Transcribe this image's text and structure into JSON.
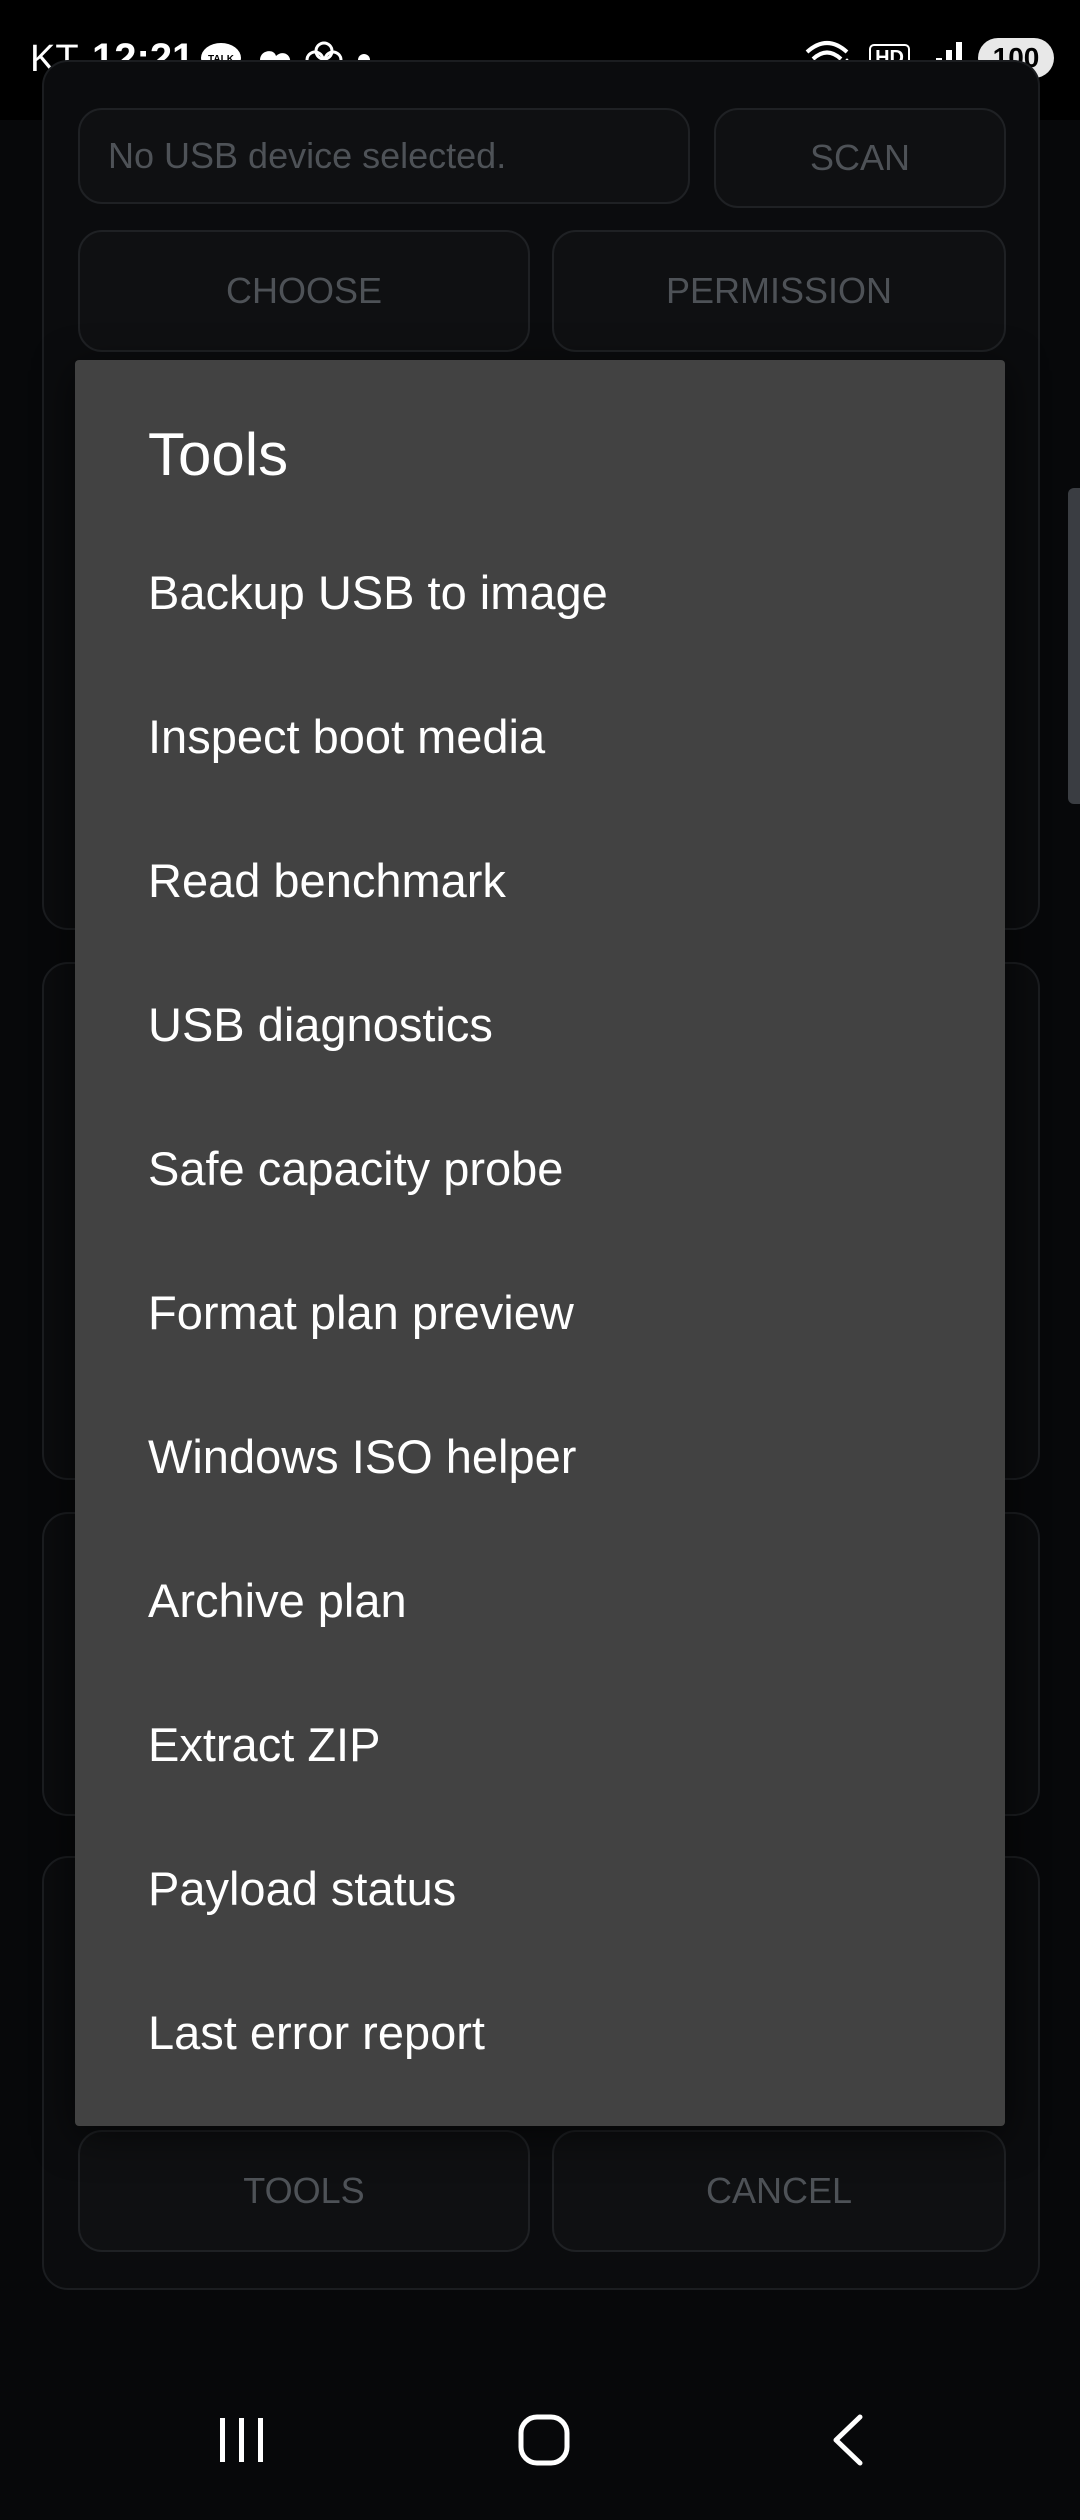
{
  "status_bar": {
    "carrier": "KT",
    "time": "12:21",
    "talk_badge": "TALK",
    "battery": "100",
    "hd_badge": "HD"
  },
  "background": {
    "device_field": "No USB device selected.",
    "scan_label": "SCAN",
    "choose_label": "CHOOSE",
    "permission_label": "PERMISSION",
    "tools_label": "TOOLS",
    "cancel_label": "CANCEL"
  },
  "dialog": {
    "title": "Tools",
    "items": [
      {
        "label": "Backup USB to image"
      },
      {
        "label": "Inspect boot media"
      },
      {
        "label": "Read benchmark"
      },
      {
        "label": "USB diagnostics"
      },
      {
        "label": "Safe capacity probe"
      },
      {
        "label": "Format plan preview"
      },
      {
        "label": "Windows ISO helper"
      },
      {
        "label": "Archive plan"
      },
      {
        "label": "Extract ZIP"
      },
      {
        "label": "Payload status"
      },
      {
        "label": "Last error report"
      }
    ]
  },
  "nav": {
    "recents_icon": "recents-icon",
    "home_icon": "home-icon",
    "back_icon": "back-icon"
  },
  "colors": {
    "background": "#07080a",
    "dialog": "#424242",
    "text": "#ffffff",
    "muted": "#4e5257"
  }
}
